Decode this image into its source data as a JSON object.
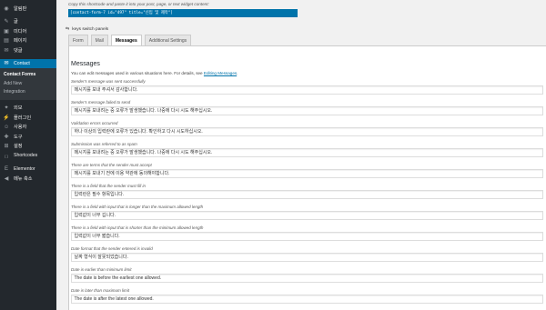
{
  "sidebar": {
    "items": [
      {
        "icon": "dashboard-icon",
        "glyph": "◉",
        "label": "알림판"
      },
      {
        "icon": "pin-icon",
        "glyph": "✎",
        "label": "글"
      },
      {
        "icon": "media-icon",
        "glyph": "▣",
        "label": "미디어"
      },
      {
        "icon": "page-icon",
        "glyph": "▤",
        "label": "페이지"
      },
      {
        "icon": "comment-icon",
        "glyph": "✉",
        "label": "댓글"
      },
      {
        "icon": "mail-icon",
        "glyph": "✉",
        "label": "Contact"
      }
    ],
    "submenu": [
      {
        "label": "Contact Forms"
      },
      {
        "label": "Add New"
      },
      {
        "label": "Integration"
      }
    ],
    "items2": [
      {
        "icon": "appearance-icon",
        "glyph": "✦",
        "label": "외모"
      },
      {
        "icon": "plugin-icon",
        "glyph": "⚡",
        "label": "플러그인"
      },
      {
        "icon": "user-icon",
        "glyph": "☺",
        "label": "사용자"
      },
      {
        "icon": "tool-icon",
        "glyph": "✚",
        "label": "도구"
      },
      {
        "icon": "settings-icon",
        "glyph": "⊞",
        "label": "설정"
      },
      {
        "icon": "shortcode-icon",
        "glyph": "[ ]",
        "label": "Shortcodes"
      },
      {
        "icon": "elementor-icon",
        "glyph": "E",
        "label": "Elementor"
      },
      {
        "icon": "collapse-icon",
        "glyph": "◀",
        "label": "메뉴 축소"
      }
    ]
  },
  "shortcode": {
    "hint": "Copy this shortcode and paste it into your post, page, or text widget content:",
    "code": "[contact-form-7 id=\"497\" title=\"신입 및 제작\"]"
  },
  "keys_note": "keys switch panels",
  "tabs": [
    "Form",
    "Mail",
    "Messages",
    "Additional Settings"
  ],
  "panel": {
    "title": "Messages",
    "desc": "You can edit messages used in various situations here. For details, see ",
    "desc_link": "Editing Messages",
    "desc_end": "."
  },
  "messages": [
    {
      "label": "Sender's message was sent successfully",
      "value": "메시지를 보내 주셔서 감사합니다."
    },
    {
      "label": "Sender's message failed to send",
      "value": "메시지를 보내려는 중 오류가 발생했습니다. 나중에 다시 시도 해주십시오."
    },
    {
      "label": "Validation errors occurred",
      "value": "하나 이상의 입력란에 오류가 있습니다. 확인하고 다시 시도하십시오."
    },
    {
      "label": "Submission was referred to as spam",
      "value": "메시지를 보내려는 중 오류가 발생했습니다. 나중에 다시 시도 해주십시오."
    },
    {
      "label": "There are terms that the sender must accept",
      "value": "메시지를 보내기 전에 이용 약관에 동의해야합니다."
    },
    {
      "label": "There is a field that the sender must fill in",
      "value": "입력란은 필수 항목입니다."
    },
    {
      "label": "There is a field with input that is longer than the maximum allowed length",
      "value": "입력값이 너무 깁니다."
    },
    {
      "label": "There is a field with input that is shorter than the minimum allowed length",
      "value": "입력값이 너무 짧습니다."
    },
    {
      "label": "Date format that the sender entered is invalid",
      "value": "날짜 형식이 잘못되었습니다."
    },
    {
      "label": "Date is earlier than minimum limit",
      "value": "The date is before the earliest one allowed."
    },
    {
      "label": "Date is later than maximum limit",
      "value": "The date is after the latest one allowed."
    }
  ]
}
